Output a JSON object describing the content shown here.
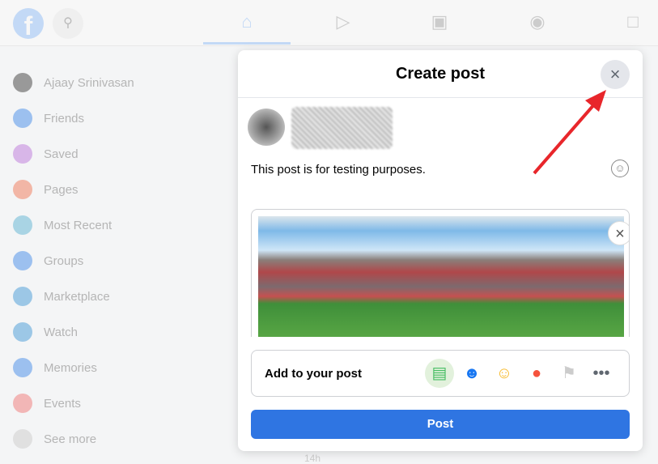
{
  "topbar": {
    "logo": "f",
    "nav_icons": [
      "home-icon",
      "watch-icon",
      "marketplace-icon",
      "groups-icon",
      "gaming-icon"
    ],
    "active": "home-icon"
  },
  "sidebar": {
    "items": [
      {
        "label": "Ajaay Srinivasan",
        "color": "#999"
      },
      {
        "label": "Friends",
        "color": "#9cc0ef"
      },
      {
        "label": "Saved",
        "color": "#d8b6e8"
      },
      {
        "label": "Pages",
        "color": "#f2b6a6"
      },
      {
        "label": "Most Recent",
        "color": "#a9d4e4"
      },
      {
        "label": "Groups",
        "color": "#9cc0ef"
      },
      {
        "label": "Marketplace",
        "color": "#9cc7e6"
      },
      {
        "label": "Watch",
        "color": "#9cc7e6"
      },
      {
        "label": "Memories",
        "color": "#9cc0ef"
      },
      {
        "label": "Events",
        "color": "#f2b6b6"
      },
      {
        "label": "See more",
        "color": "#e0e0e0"
      }
    ]
  },
  "background_feed": {
    "time": "14h"
  },
  "modal": {
    "title": "Create post",
    "close_label": "×",
    "post_text": "This post is for testing purposes.",
    "add_to_post": "Add to your post",
    "post_button": "Post",
    "add_icons": [
      "photo-video-icon",
      "tag-people-icon",
      "feeling-icon",
      "check-in-icon",
      "flag-icon",
      "more-icon"
    ]
  },
  "colors": {
    "accent": "#2f75e2",
    "annotation_arrow": "#e8262b"
  }
}
